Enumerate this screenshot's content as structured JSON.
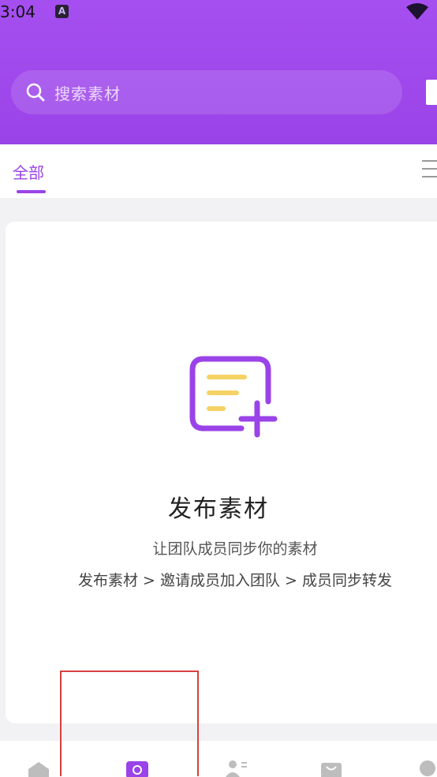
{
  "status_bar": {
    "time": "3:04",
    "badge": "A"
  },
  "search": {
    "placeholder": "搜索素材"
  },
  "tabs": {
    "active_label": "全部"
  },
  "empty_state": {
    "title": "发布素材",
    "subtitle": "让团队成员同步你的素材",
    "steps": "发布素材 > 邀请成员加入团队 > 成员同步转发"
  },
  "colors": {
    "accent": "#9a43e8",
    "icon_yellow": "#f5d264"
  },
  "icons": [
    "search-icon",
    "menu-icon",
    "doc-plus-icon",
    "home-icon",
    "sync-icon",
    "contacts-icon",
    "shop-icon",
    "profile-icon"
  ]
}
